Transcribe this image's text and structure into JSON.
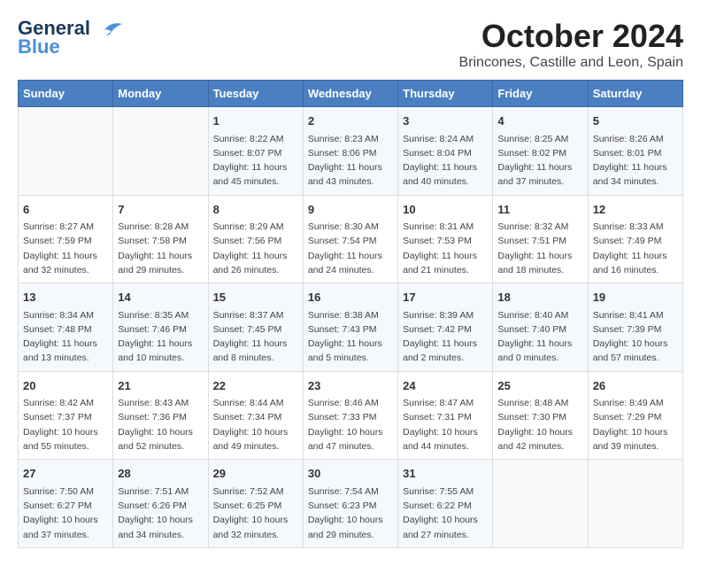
{
  "header": {
    "logo_line1": "General",
    "logo_line2": "Blue",
    "month": "October 2024",
    "location": "Brincones, Castille and Leon, Spain"
  },
  "columns": [
    "Sunday",
    "Monday",
    "Tuesday",
    "Wednesday",
    "Thursday",
    "Friday",
    "Saturday"
  ],
  "weeks": [
    [
      {
        "day": "",
        "content": ""
      },
      {
        "day": "",
        "content": ""
      },
      {
        "day": "1",
        "content": "Sunrise: 8:22 AM\nSunset: 8:07 PM\nDaylight: 11 hours\nand 45 minutes."
      },
      {
        "day": "2",
        "content": "Sunrise: 8:23 AM\nSunset: 8:06 PM\nDaylight: 11 hours\nand 43 minutes."
      },
      {
        "day": "3",
        "content": "Sunrise: 8:24 AM\nSunset: 8:04 PM\nDaylight: 11 hours\nand 40 minutes."
      },
      {
        "day": "4",
        "content": "Sunrise: 8:25 AM\nSunset: 8:02 PM\nDaylight: 11 hours\nand 37 minutes."
      },
      {
        "day": "5",
        "content": "Sunrise: 8:26 AM\nSunset: 8:01 PM\nDaylight: 11 hours\nand 34 minutes."
      }
    ],
    [
      {
        "day": "6",
        "content": "Sunrise: 8:27 AM\nSunset: 7:59 PM\nDaylight: 11 hours\nand 32 minutes."
      },
      {
        "day": "7",
        "content": "Sunrise: 8:28 AM\nSunset: 7:58 PM\nDaylight: 11 hours\nand 29 minutes."
      },
      {
        "day": "8",
        "content": "Sunrise: 8:29 AM\nSunset: 7:56 PM\nDaylight: 11 hours\nand 26 minutes."
      },
      {
        "day": "9",
        "content": "Sunrise: 8:30 AM\nSunset: 7:54 PM\nDaylight: 11 hours\nand 24 minutes."
      },
      {
        "day": "10",
        "content": "Sunrise: 8:31 AM\nSunset: 7:53 PM\nDaylight: 11 hours\nand 21 minutes."
      },
      {
        "day": "11",
        "content": "Sunrise: 8:32 AM\nSunset: 7:51 PM\nDaylight: 11 hours\nand 18 minutes."
      },
      {
        "day": "12",
        "content": "Sunrise: 8:33 AM\nSunset: 7:49 PM\nDaylight: 11 hours\nand 16 minutes."
      }
    ],
    [
      {
        "day": "13",
        "content": "Sunrise: 8:34 AM\nSunset: 7:48 PM\nDaylight: 11 hours\nand 13 minutes."
      },
      {
        "day": "14",
        "content": "Sunrise: 8:35 AM\nSunset: 7:46 PM\nDaylight: 11 hours\nand 10 minutes."
      },
      {
        "day": "15",
        "content": "Sunrise: 8:37 AM\nSunset: 7:45 PM\nDaylight: 11 hours\nand 8 minutes."
      },
      {
        "day": "16",
        "content": "Sunrise: 8:38 AM\nSunset: 7:43 PM\nDaylight: 11 hours\nand 5 minutes."
      },
      {
        "day": "17",
        "content": "Sunrise: 8:39 AM\nSunset: 7:42 PM\nDaylight: 11 hours\nand 2 minutes."
      },
      {
        "day": "18",
        "content": "Sunrise: 8:40 AM\nSunset: 7:40 PM\nDaylight: 11 hours\nand 0 minutes."
      },
      {
        "day": "19",
        "content": "Sunrise: 8:41 AM\nSunset: 7:39 PM\nDaylight: 10 hours\nand 57 minutes."
      }
    ],
    [
      {
        "day": "20",
        "content": "Sunrise: 8:42 AM\nSunset: 7:37 PM\nDaylight: 10 hours\nand 55 minutes."
      },
      {
        "day": "21",
        "content": "Sunrise: 8:43 AM\nSunset: 7:36 PM\nDaylight: 10 hours\nand 52 minutes."
      },
      {
        "day": "22",
        "content": "Sunrise: 8:44 AM\nSunset: 7:34 PM\nDaylight: 10 hours\nand 49 minutes."
      },
      {
        "day": "23",
        "content": "Sunrise: 8:46 AM\nSunset: 7:33 PM\nDaylight: 10 hours\nand 47 minutes."
      },
      {
        "day": "24",
        "content": "Sunrise: 8:47 AM\nSunset: 7:31 PM\nDaylight: 10 hours\nand 44 minutes."
      },
      {
        "day": "25",
        "content": "Sunrise: 8:48 AM\nSunset: 7:30 PM\nDaylight: 10 hours\nand 42 minutes."
      },
      {
        "day": "26",
        "content": "Sunrise: 8:49 AM\nSunset: 7:29 PM\nDaylight: 10 hours\nand 39 minutes."
      }
    ],
    [
      {
        "day": "27",
        "content": "Sunrise: 7:50 AM\nSunset: 6:27 PM\nDaylight: 10 hours\nand 37 minutes."
      },
      {
        "day": "28",
        "content": "Sunrise: 7:51 AM\nSunset: 6:26 PM\nDaylight: 10 hours\nand 34 minutes."
      },
      {
        "day": "29",
        "content": "Sunrise: 7:52 AM\nSunset: 6:25 PM\nDaylight: 10 hours\nand 32 minutes."
      },
      {
        "day": "30",
        "content": "Sunrise: 7:54 AM\nSunset: 6:23 PM\nDaylight: 10 hours\nand 29 minutes."
      },
      {
        "day": "31",
        "content": "Sunrise: 7:55 AM\nSunset: 6:22 PM\nDaylight: 10 hours\nand 27 minutes."
      },
      {
        "day": "",
        "content": ""
      },
      {
        "day": "",
        "content": ""
      }
    ]
  ]
}
